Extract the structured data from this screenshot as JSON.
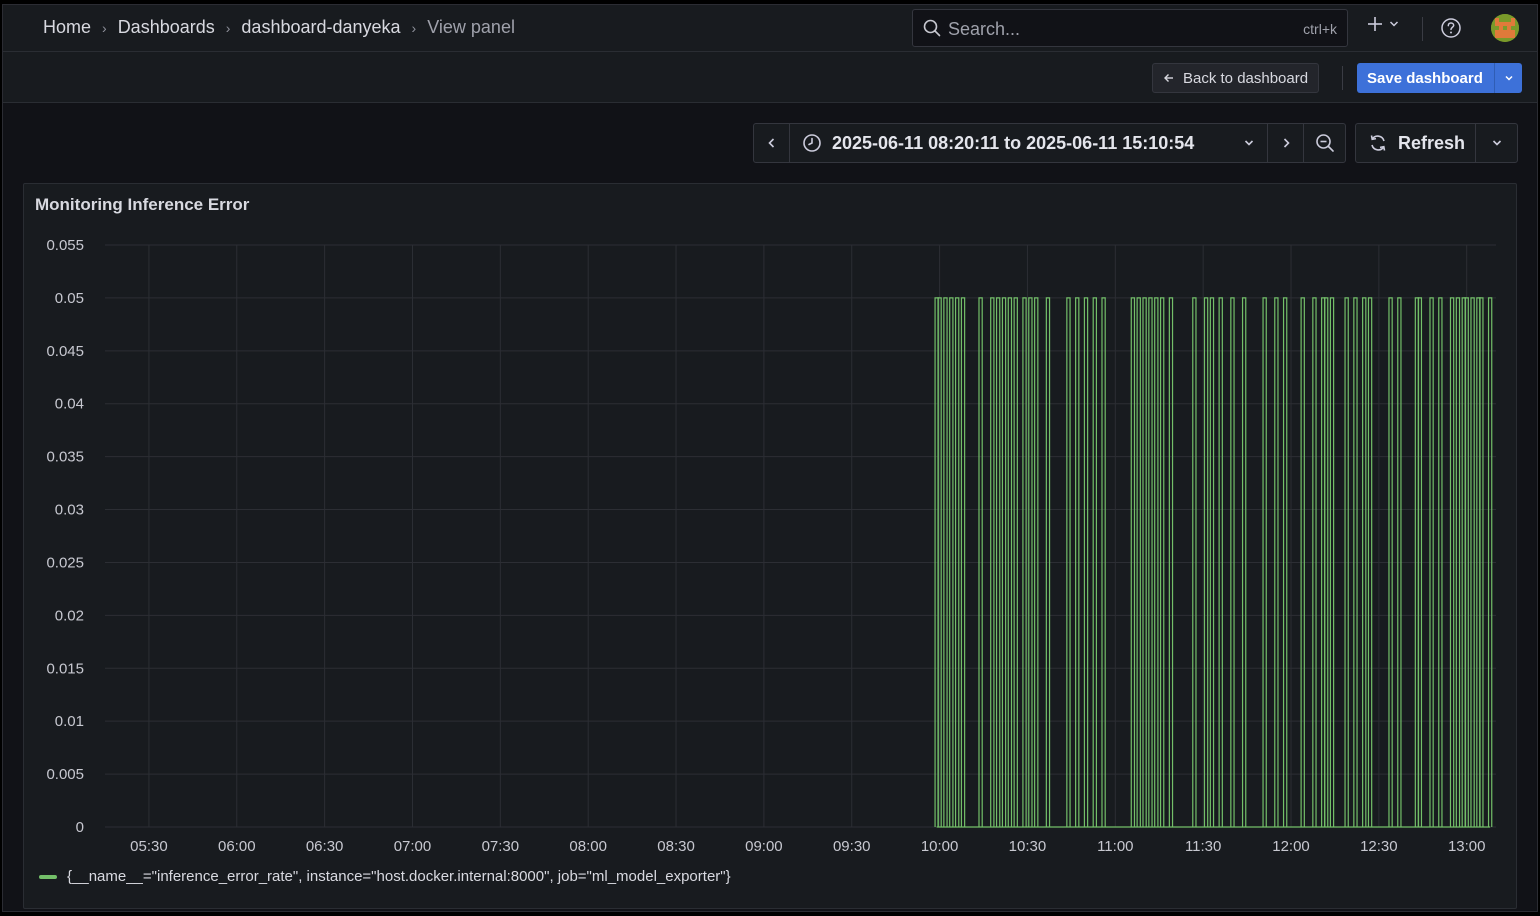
{
  "breadcrumbs": [
    "Home",
    "Dashboards",
    "dashboard-danyeka",
    "View panel"
  ],
  "search": {
    "placeholder": "Search...",
    "shortcut": "ctrl+k"
  },
  "toolbar": {
    "back_label": "Back to dashboard",
    "save_label": "Save dashboard"
  },
  "time_picker": {
    "range": "2025-06-11 08:20:11 to 2025-06-11 15:10:54",
    "refresh_label": "Refresh"
  },
  "panel": {
    "title": "Monitoring Inference Error",
    "legend": "{__name__=\"inference_error_rate\", instance=\"host.docker.internal:8000\", job=\"ml_model_exporter\"}"
  },
  "colors": {
    "series": "#73bf69",
    "accent": "#3d71d9",
    "background": "#111217",
    "panel": "#181b1f"
  },
  "chart_data": {
    "type": "line",
    "title": "Monitoring Inference Error",
    "x_ticks": [
      "05:30",
      "06:00",
      "06:30",
      "07:00",
      "07:30",
      "08:00",
      "08:30",
      "09:00",
      "09:30",
      "10:00",
      "10:30",
      "11:00",
      "11:30",
      "12:00",
      "12:30",
      "13:00"
    ],
    "y_ticks": [
      "0",
      "0.005",
      "0.01",
      "0.015",
      "0.02",
      "0.025",
      "0.03",
      "0.035",
      "0.04",
      "0.045",
      "0.05",
      "0.055"
    ],
    "ylim": [
      0,
      0.055
    ],
    "grid": true,
    "legend_position": "bottom-left",
    "series": [
      {
        "name": "{__name__=\"inference_error_rate\", instance=\"host.docker.internal:8000\", job=\"ml_model_exporter\"}",
        "x_start": "09:59",
        "x_end": "13:08",
        "pattern": "binary toggle between 0 and 0.05",
        "spikes_at_0_05": [
          "09:59",
          "10:00",
          "10:02",
          "10:04",
          "10:06",
          "10:08",
          "10:14",
          "10:18",
          "10:20",
          "10:22",
          "10:24",
          "10:26",
          "10:29",
          "10:31",
          "10:33",
          "10:37",
          "10:44",
          "10:47",
          "10:50",
          "10:53",
          "10:56",
          "11:06",
          "11:08",
          "11:10",
          "11:12",
          "11:14",
          "11:16",
          "11:19",
          "11:27",
          "11:31",
          "11:33",
          "11:36",
          "11:40",
          "11:44",
          "11:51",
          "11:55",
          "11:58",
          "12:04",
          "12:08",
          "12:11",
          "12:12",
          "12:14",
          "12:19",
          "12:22",
          "12:25",
          "12:27",
          "12:34",
          "12:37",
          "12:43",
          "12:44",
          "12:48",
          "12:51",
          "12:55",
          "12:57",
          "12:59",
          "13:00",
          "13:02",
          "13:04",
          "13:05",
          "13:08"
        ]
      }
    ]
  }
}
